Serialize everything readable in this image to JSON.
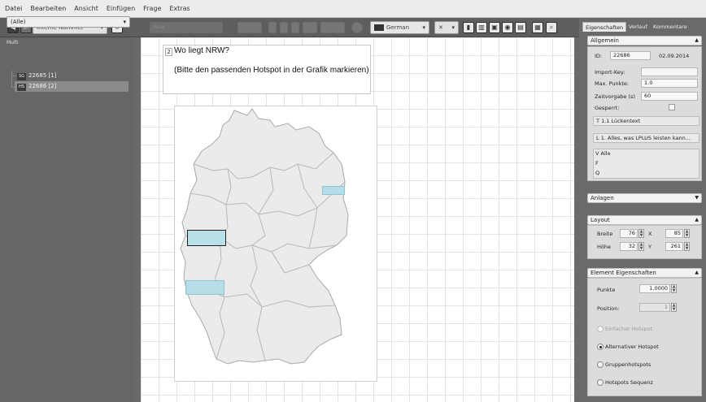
{
  "menu": [
    "Datei",
    "Bearbeiten",
    "Ansicht",
    "Einfügen",
    "Frage",
    "Extras"
  ],
  "toolbar": {
    "sort_combo": "Interne Nummer",
    "format_combo": "Arial",
    "language": "German"
  },
  "left": {
    "panel_label": "Multi",
    "filter": "(Alle)",
    "items": [
      {
        "tag": "SG",
        "label": "22685 [1]"
      },
      {
        "tag": "HS",
        "label": "22686 [2]"
      }
    ]
  },
  "question": {
    "number": "2",
    "title": "Wo liegt NRW?",
    "instruction": "(Bitte den passenden Hotspot in der Grafik markieren)"
  },
  "right": {
    "tabs": [
      "Eigenschaften",
      "Verlauf",
      "Kommentare"
    ],
    "allgemein": {
      "header": "Allgemein",
      "id_label": "ID:",
      "id": "22686",
      "date": "02.09.2014",
      "import_label": "Import-Key:",
      "import_value": "",
      "maxpunkte_label": "Max. Punkte:",
      "maxpunkte": "1.0",
      "zeit_label": "Zeitvorgabe (s)",
      "zeit": "60",
      "gesperrt_label": "Gesperrt:",
      "rows": [
        {
          "prefix": "T",
          "text": "1.1 Lückentext"
        },
        {
          "prefix": "L",
          "text": "1. Alles, was LPLUS leisten kann..."
        }
      ],
      "vfq": [
        {
          "prefix": "V",
          "text": "Alle"
        },
        {
          "prefix": "F",
          "text": ""
        },
        {
          "prefix": "Q",
          "text": ""
        }
      ]
    },
    "anlagen": {
      "header": "Anlagen"
    },
    "layout": {
      "header": "Layout",
      "breite_label": "Breite",
      "breite": "76",
      "x_label": "X",
      "x": "85",
      "hoehe_label": "Höhe",
      "hoehe": "32",
      "y_label": "Y",
      "y": "261"
    },
    "element": {
      "header": "Element Eigenschaften",
      "punkte_label": "Punkte",
      "punkte": "1.0000",
      "position_label": "Position:",
      "position": "1",
      "radios": [
        {
          "label": "Einfacher Hotspot",
          "selected": false,
          "enabled": false
        },
        {
          "label": "Alternativer Hotspot",
          "selected": true,
          "enabled": true
        },
        {
          "label": "Gruppenhotspots",
          "selected": false,
          "enabled": true
        },
        {
          "label": "Hotspots Sequenz",
          "selected": false,
          "enabled": true
        }
      ]
    }
  }
}
